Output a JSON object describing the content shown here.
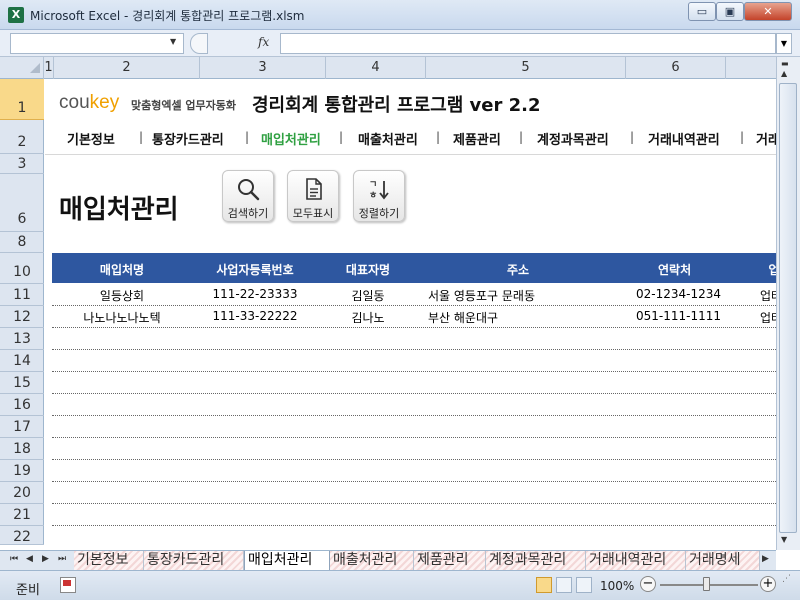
{
  "window": {
    "app_icon": "X",
    "title": "Microsoft Excel - 경리회계 통합관리 프로그램.xlsm",
    "controls": {
      "minimize": "▭",
      "maximize": "▣",
      "close": "✕"
    }
  },
  "formula_bar": {
    "name_box": "",
    "fx": "fx",
    "formula": ""
  },
  "columns": [
    "1",
    "2",
    "3",
    "4",
    "5",
    "6"
  ],
  "rows": [
    "1",
    "2",
    "3",
    "6",
    "8",
    "10",
    "11",
    "12",
    "13",
    "14",
    "15",
    "16",
    "17",
    "18",
    "19",
    "20",
    "21",
    "22"
  ],
  "selected_row": "1",
  "header": {
    "logo_cou": "cou",
    "logo_key": "key",
    "logo_tagline": "맞춤형엑셀 업무자동화",
    "app_title": "경리회계 통합관리 프로그램 ver 2.2"
  },
  "nav": {
    "items": [
      {
        "label": "기본정보",
        "active": false
      },
      {
        "label": "통장카드관리",
        "active": false
      },
      {
        "label": "매입처관리",
        "active": true
      },
      {
        "label": "매출처관리",
        "active": false
      },
      {
        "label": "제품관리",
        "active": false
      },
      {
        "label": "계정과목관리",
        "active": false
      },
      {
        "label": "거래내역관리",
        "active": false
      },
      {
        "label": "거래",
        "active": false
      }
    ],
    "separator": "|",
    "active_color": "#2fa041"
  },
  "page": {
    "title": "매입처관리",
    "buttons": [
      {
        "label": "검색하기",
        "icon": "search-icon"
      },
      {
        "label": "모두표시",
        "icon": "document-icon"
      },
      {
        "label": "정렬하기",
        "icon": "sort-icon"
      }
    ]
  },
  "table": {
    "header_color": "#2e57a0",
    "headers": [
      "매입처명",
      "사업자등록번호",
      "대표자명",
      "주소",
      "연락처",
      "업"
    ],
    "rows": [
      {
        "name": "일등상회",
        "reg_no": "111-22-23333",
        "ceo": "김일동",
        "address": "서울 영등포구 문래동",
        "phone": "02-1234-1234",
        "type": "업태"
      },
      {
        "name": "나노나노나노텍",
        "reg_no": "111-33-22222",
        "ceo": "김나노",
        "address": "부산 해운대구",
        "phone": "051-111-1111",
        "type": "업태"
      }
    ]
  },
  "sheet_tabs": {
    "nav_glyphs": [
      "⏮",
      "◀",
      "▶",
      "⏭"
    ],
    "tabs": [
      "기본정보",
      "통장카드관리",
      "매입처관리",
      "매출처관리",
      "제품관리",
      "계정과목관리",
      "거래내역관리",
      "거래명세"
    ],
    "active": "매입처관리"
  },
  "status": {
    "ready": "준비",
    "zoom": "100%",
    "zoom_minus": "−",
    "zoom_plus": "+"
  }
}
